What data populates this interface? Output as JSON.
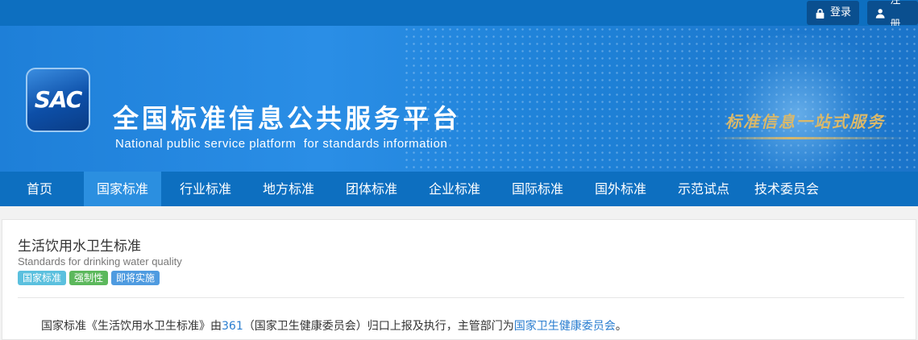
{
  "topbar": {
    "login_label": "登录",
    "register_label": "注册"
  },
  "banner": {
    "logo_text": "SAC",
    "title_cn": "全国标准信息公共服务平台",
    "title_en": "National public service platform  for standards information",
    "slogan": "标准信息一站式服务"
  },
  "nav": {
    "items": [
      {
        "label": "首页"
      },
      {
        "label": "国家标准"
      },
      {
        "label": "行业标准"
      },
      {
        "label": "地方标准"
      },
      {
        "label": "团体标准"
      },
      {
        "label": "企业标准"
      },
      {
        "label": "国际标准"
      },
      {
        "label": "国外标准"
      },
      {
        "label": "示范试点"
      },
      {
        "label": "技术委员会"
      }
    ],
    "active_index": 1
  },
  "standard": {
    "title": "生活饮用水卫生标准",
    "title_en": "Standards for drinking water quality",
    "badges": [
      {
        "label": "国家标准",
        "color": "#5bc0de"
      },
      {
        "label": "强制性",
        "color": "#5cb85c"
      },
      {
        "label": "即将实施",
        "color": "#4f9be0"
      }
    ],
    "desc_prefix": "国家标准《生活饮用水卫生标准》由",
    "tc_code": "361",
    "desc_mid": "（国家卫生健康委员会）归口上报及执行，主管部门为",
    "authority": "国家卫生健康委员会",
    "desc_suffix": "。"
  },
  "colors": {
    "nav_bg": "#0d6fc0",
    "nav_active": "#2b8fe0",
    "link": "#2a7ed0"
  }
}
